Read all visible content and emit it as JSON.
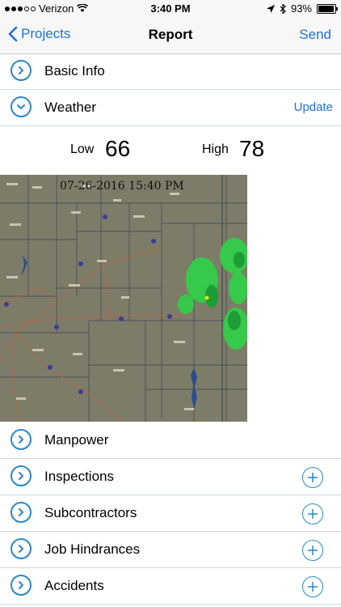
{
  "status": {
    "carrier": "Verizon",
    "time": "3:40 PM",
    "battery": "93%",
    "battery_level": 0.93
  },
  "nav": {
    "back_label": "Projects",
    "title": "Report",
    "send_label": "Send"
  },
  "sections": {
    "basic_info": "Basic Info",
    "weather": "Weather",
    "weather_action": "Update",
    "manpower": "Manpower",
    "inspections": "Inspections",
    "subcontractors": "Subcontractors",
    "job_hindrances": "Job Hindrances",
    "accidents": "Accidents"
  },
  "weather": {
    "low_label": "Low",
    "low_value": "66",
    "high_label": "High",
    "high_value": "78",
    "radar_timestamp": "07-26-2016 15:40 PM"
  },
  "colors": {
    "accent": "#1a73d9",
    "icon_ring": "#2a86c9"
  }
}
